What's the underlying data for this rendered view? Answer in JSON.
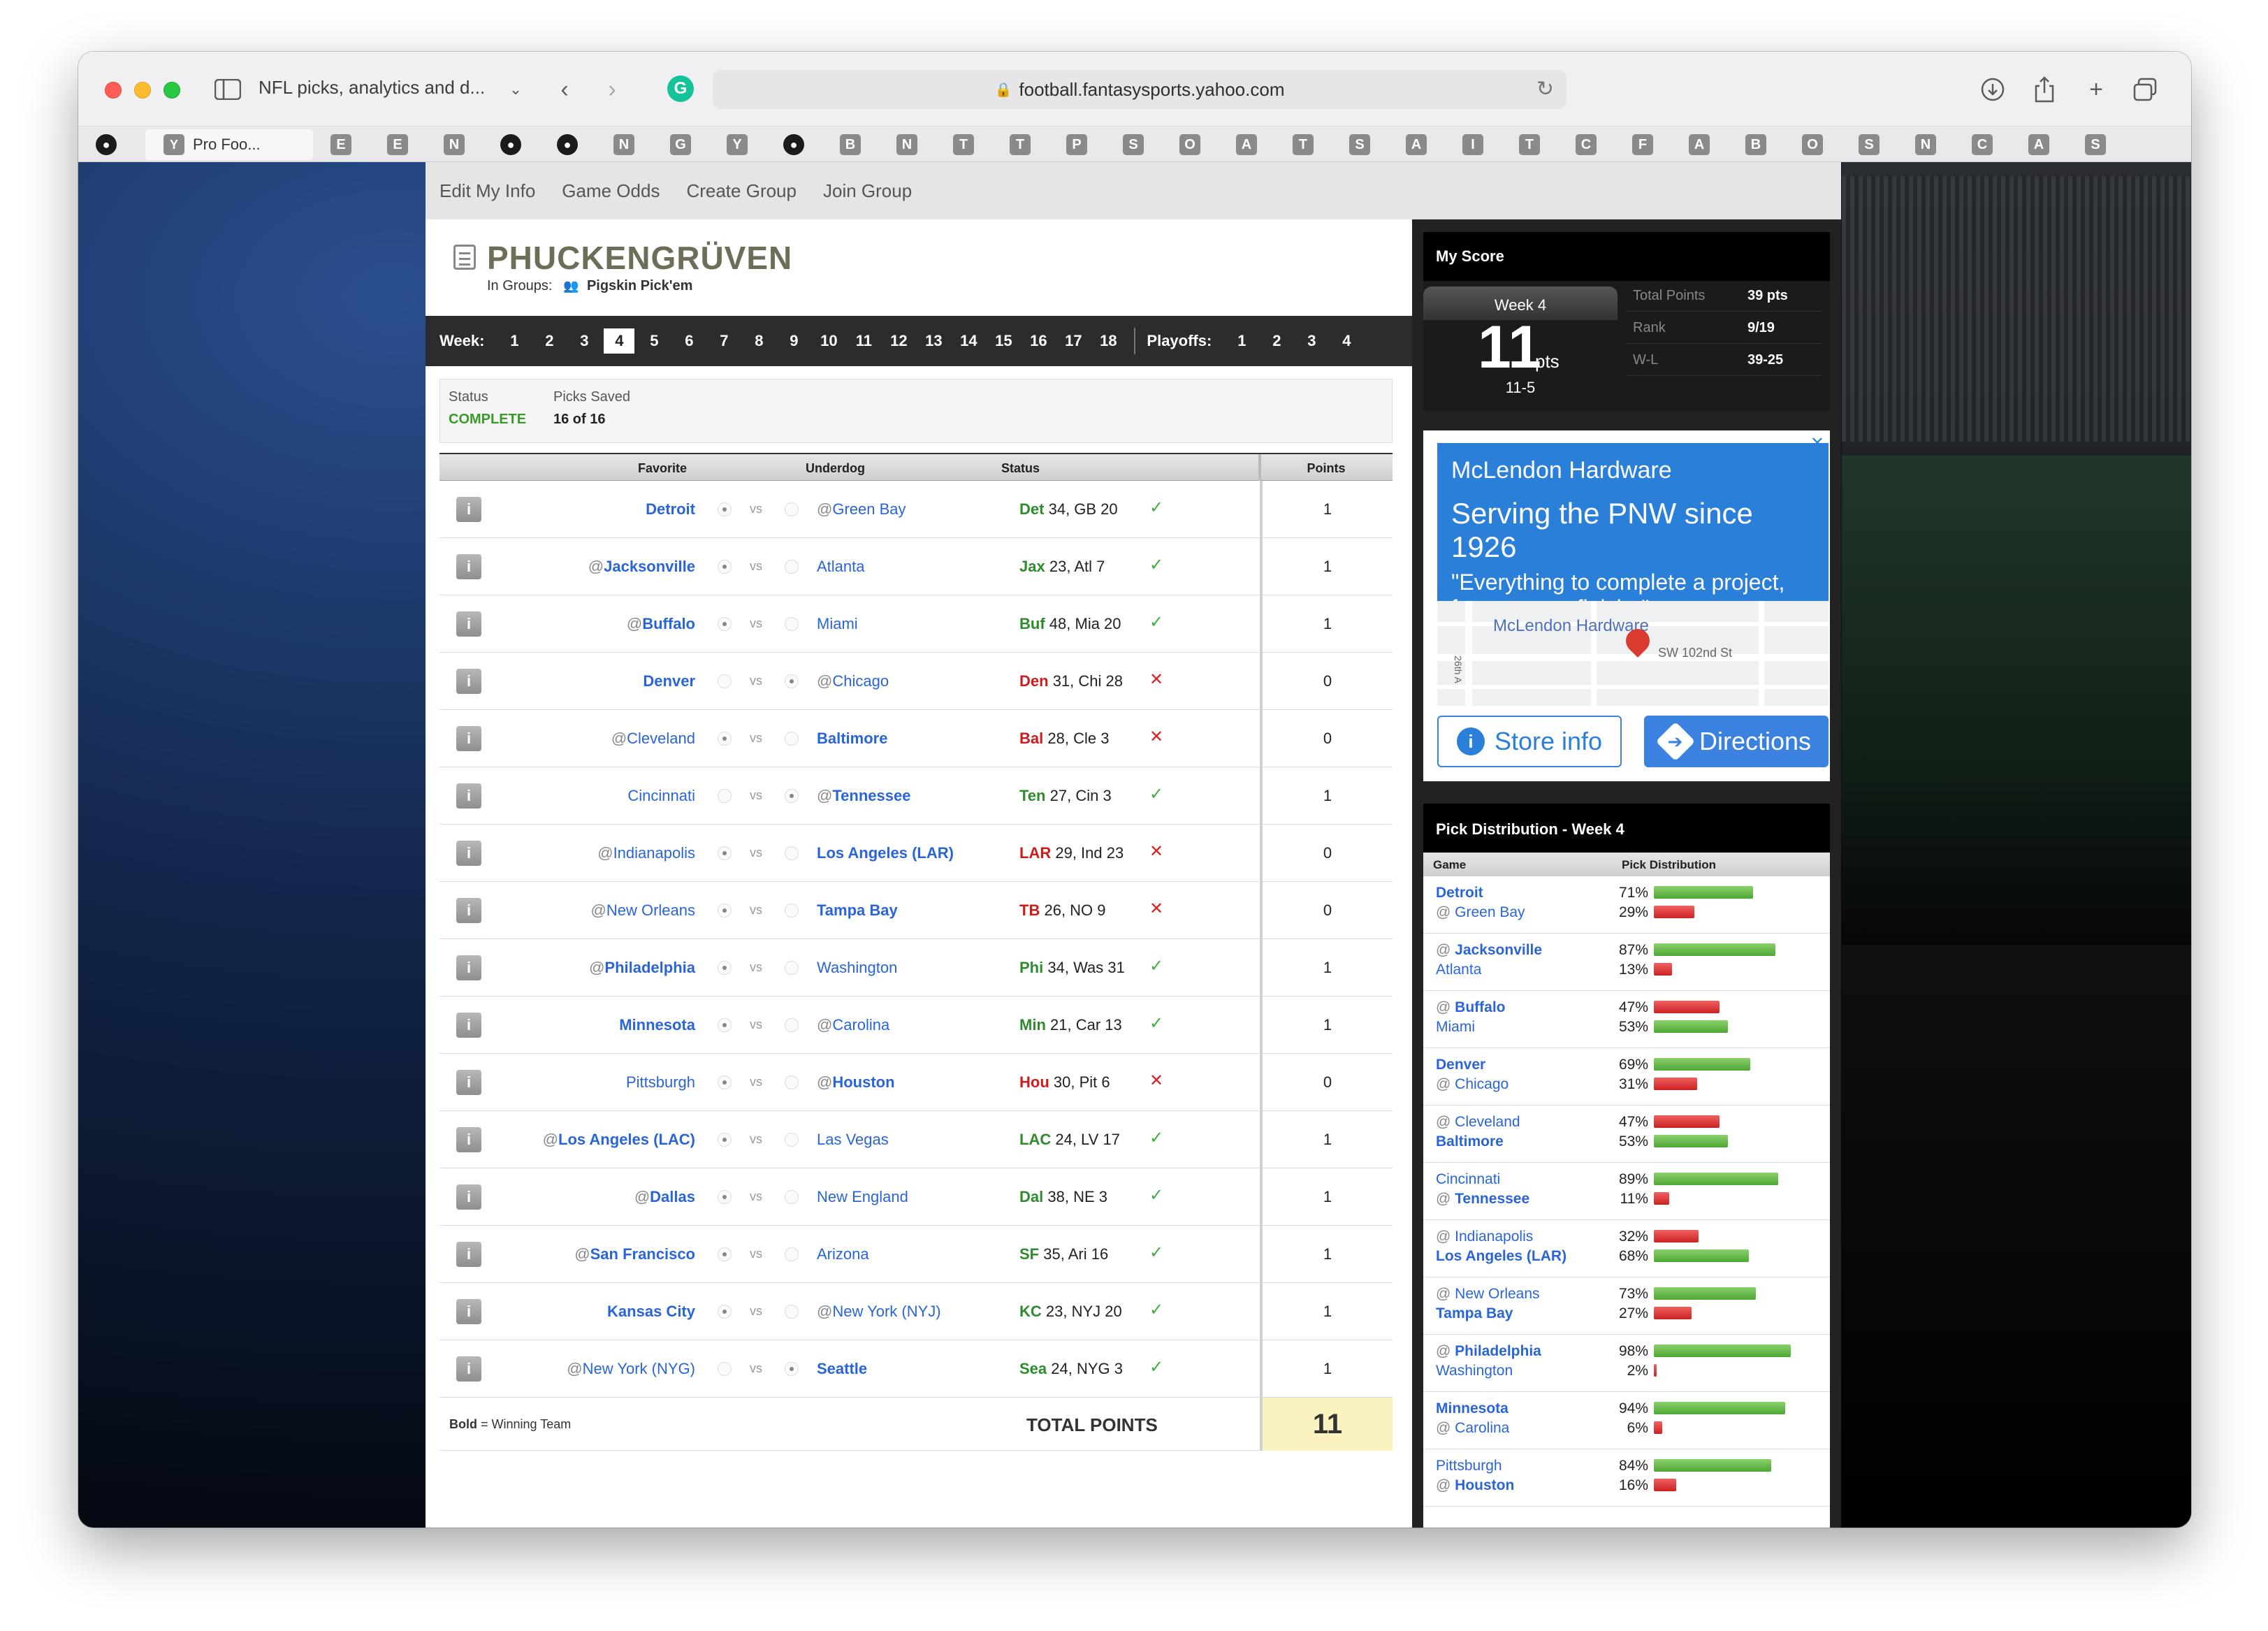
{
  "browser": {
    "tab_title": "NFL picks, analytics and d...",
    "url": "football.fantasysports.yahoo.com",
    "favorites": [
      {
        "kind": "gh",
        "letter": ""
      },
      {
        "kind": "active",
        "letter": "Y",
        "label": "Pro Foo..."
      },
      {
        "kind": "sq",
        "letter": "E"
      },
      {
        "kind": "sq",
        "letter": "E"
      },
      {
        "kind": "sq",
        "letter": "N"
      },
      {
        "kind": "gh",
        "letter": ""
      },
      {
        "kind": "gh",
        "letter": ""
      },
      {
        "kind": "sq",
        "letter": "N"
      },
      {
        "kind": "sq",
        "letter": "G"
      },
      {
        "kind": "sq",
        "letter": "Y"
      },
      {
        "kind": "gh",
        "letter": ""
      },
      {
        "kind": "sq",
        "letter": "B"
      },
      {
        "kind": "sq",
        "letter": "N"
      },
      {
        "kind": "sq",
        "letter": "T"
      },
      {
        "kind": "sq",
        "letter": "T"
      },
      {
        "kind": "sq",
        "letter": "P"
      },
      {
        "kind": "sq",
        "letter": "S"
      },
      {
        "kind": "sq",
        "letter": "O"
      },
      {
        "kind": "sq",
        "letter": "A"
      },
      {
        "kind": "sq",
        "letter": "T"
      },
      {
        "kind": "sq",
        "letter": "S"
      },
      {
        "kind": "sq",
        "letter": "A"
      },
      {
        "kind": "sq",
        "letter": "I"
      },
      {
        "kind": "sq",
        "letter": "T"
      },
      {
        "kind": "sq",
        "letter": "C"
      },
      {
        "kind": "sq",
        "letter": "F"
      },
      {
        "kind": "sq",
        "letter": "A"
      },
      {
        "kind": "sq",
        "letter": "B"
      },
      {
        "kind": "sq",
        "letter": "O"
      },
      {
        "kind": "sq",
        "letter": "S"
      },
      {
        "kind": "sq",
        "letter": "N"
      },
      {
        "kind": "sq",
        "letter": "C"
      },
      {
        "kind": "sq",
        "letter": "A"
      },
      {
        "kind": "sq",
        "letter": "S"
      }
    ]
  },
  "nav": {
    "links": [
      "Edit My Info",
      "Game Odds",
      "Create Group",
      "Join Group"
    ]
  },
  "header": {
    "title": "PHUCKENGRÜVEN",
    "groups_label": "In Groups:",
    "group_name": "Pigskin Pick'em"
  },
  "weeks": {
    "label": "Week:",
    "items": [
      "1",
      "2",
      "3",
      "4",
      "5",
      "6",
      "7",
      "8",
      "9",
      "10",
      "11",
      "12",
      "13",
      "14",
      "15",
      "16",
      "17",
      "18"
    ],
    "active": "4",
    "playoffs_label": "Playoffs:",
    "playoffs": [
      "1",
      "2",
      "3",
      "4"
    ]
  },
  "status": {
    "status_label": "Status",
    "status_value": "COMPLETE",
    "saved_label": "Picks Saved",
    "saved_value": "16 of 16"
  },
  "table": {
    "headers": {
      "favorite": "Favorite",
      "underdog": "Underdog",
      "status": "Status",
      "points": "Points"
    },
    "vs": "vs",
    "rows": [
      {
        "fav_at": false,
        "fav": "Detroit",
        "fav_bold": true,
        "und_at": true,
        "und": "Green Bay",
        "und_bold": false,
        "pick": "fav",
        "winner": "Det",
        "winner_score": "34",
        "rest": ", GB 20",
        "correct": true,
        "points": "1"
      },
      {
        "fav_at": true,
        "fav": "Jacksonville",
        "fav_bold": true,
        "und_at": false,
        "und": "Atlanta",
        "und_bold": false,
        "pick": "fav",
        "winner": "Jax",
        "winner_score": "23",
        "rest": ", Atl 7",
        "correct": true,
        "points": "1"
      },
      {
        "fav_at": true,
        "fav": "Buffalo",
        "fav_bold": true,
        "und_at": false,
        "und": "Miami",
        "und_bold": false,
        "pick": "fav",
        "winner": "Buf",
        "winner_score": "48",
        "rest": ", Mia 20",
        "correct": true,
        "points": "1"
      },
      {
        "fav_at": false,
        "fav": "Denver",
        "fav_bold": true,
        "und_at": true,
        "und": "Chicago",
        "und_bold": false,
        "pick": "und",
        "winner": "Den",
        "winner_score": "31",
        "rest": ", Chi 28",
        "correct": false,
        "points": "0"
      },
      {
        "fav_at": true,
        "fav": "Cleveland",
        "fav_bold": false,
        "und_at": false,
        "und": "Baltimore",
        "und_bold": true,
        "pick": "fav",
        "winner": "Bal",
        "winner_score": "28",
        "rest": ", Cle 3",
        "correct": false,
        "points": "0"
      },
      {
        "fav_at": false,
        "fav": "Cincinnati",
        "fav_bold": false,
        "und_at": true,
        "und": "Tennessee",
        "und_bold": true,
        "pick": "und",
        "winner": "Ten",
        "winner_score": "27",
        "rest": ", Cin 3",
        "correct": true,
        "points": "1"
      },
      {
        "fav_at": true,
        "fav": "Indianapolis",
        "fav_bold": false,
        "und_at": false,
        "und": "Los Angeles (LAR)",
        "und_bold": true,
        "pick": "fav",
        "winner": "LAR",
        "winner_score": "29",
        "rest": ", Ind 23",
        "correct": false,
        "points": "0"
      },
      {
        "fav_at": true,
        "fav": "New Orleans",
        "fav_bold": false,
        "und_at": false,
        "und": "Tampa Bay",
        "und_bold": true,
        "pick": "fav",
        "winner": "TB",
        "winner_score": "26",
        "rest": ", NO 9",
        "correct": false,
        "points": "0"
      },
      {
        "fav_at": true,
        "fav": "Philadelphia",
        "fav_bold": true,
        "und_at": false,
        "und": "Washington",
        "und_bold": false,
        "pick": "fav",
        "winner": "Phi",
        "winner_score": "34",
        "rest": ", Was 31",
        "correct": true,
        "points": "1"
      },
      {
        "fav_at": false,
        "fav": "Minnesota",
        "fav_bold": true,
        "und_at": true,
        "und": "Carolina",
        "und_bold": false,
        "pick": "fav",
        "winner": "Min",
        "winner_score": "21",
        "rest": ", Car 13",
        "correct": true,
        "points": "1"
      },
      {
        "fav_at": false,
        "fav": "Pittsburgh",
        "fav_bold": false,
        "und_at": true,
        "und": "Houston",
        "und_bold": true,
        "pick": "fav",
        "winner": "Hou",
        "winner_score": "30",
        "rest": ", Pit 6",
        "correct": false,
        "points": "0"
      },
      {
        "fav_at": true,
        "fav": "Los Angeles (LAC)",
        "fav_bold": true,
        "und_at": false,
        "und": "Las Vegas",
        "und_bold": false,
        "pick": "fav",
        "winner": "LAC",
        "winner_score": "24",
        "rest": ", LV 17",
        "correct": true,
        "points": "1"
      },
      {
        "fav_at": true,
        "fav": "Dallas",
        "fav_bold": true,
        "und_at": false,
        "und": "New England",
        "und_bold": false,
        "pick": "fav",
        "winner": "Dal",
        "winner_score": "38",
        "rest": ", NE 3",
        "correct": true,
        "points": "1"
      },
      {
        "fav_at": true,
        "fav": "San Francisco",
        "fav_bold": true,
        "und_at": false,
        "und": "Arizona",
        "und_bold": false,
        "pick": "fav",
        "winner": "SF",
        "winner_score": "35",
        "rest": ", Ari 16",
        "correct": true,
        "points": "1"
      },
      {
        "fav_at": false,
        "fav": "Kansas City",
        "fav_bold": true,
        "und_at": true,
        "und": "New York (NYJ)",
        "und_bold": false,
        "pick": "fav",
        "winner": "KC",
        "winner_score": "23",
        "rest": ", NYJ 20",
        "correct": true,
        "points": "1"
      },
      {
        "fav_at": true,
        "fav": "New York (NYG)",
        "fav_bold": false,
        "und_at": false,
        "und": "Seattle",
        "und_bold": true,
        "pick": "und",
        "winner": "Sea",
        "winner_score": "24",
        "rest": ", NYG 3",
        "correct": true,
        "points": "1"
      }
    ],
    "footer": {
      "legend_bold": "Bold",
      "legend_rest": " = Winning Team",
      "total_label": "TOTAL POINTS",
      "total_value": "11"
    }
  },
  "my_score": {
    "title": "My Score",
    "week_label": "Week 4",
    "points": "11",
    "pts_label": "pts",
    "record": "11-5",
    "stats": [
      {
        "label": "Total Points",
        "value": "39 pts"
      },
      {
        "label": "Rank",
        "value": "9/19"
      },
      {
        "label": "W-L",
        "value": "39-25"
      }
    ]
  },
  "ad": {
    "name": "McLendon Hardware",
    "headline": "Serving the PNW since 1926",
    "sub": "\"Everything to complete a project, from start to finish. \"",
    "map_name": "McLendon Hardware",
    "map_street": "SW 102nd St",
    "map_street2": "26th A",
    "store_btn": "Store info",
    "dir_btn": "Directions"
  },
  "distribution": {
    "title": "Pick Distribution - Week 4",
    "col_game": "Game",
    "col_dist": "Pick Distribution",
    "rows": [
      {
        "t1_at": false,
        "t1": "Detroit",
        "t1_bold": true,
        "p1": 71,
        "t1_win": true,
        "t2_at": true,
        "t2": "Green Bay",
        "t2_bold": false,
        "p2": 29
      },
      {
        "t1_at": true,
        "t1": "Jacksonville",
        "t1_bold": true,
        "p1": 87,
        "t1_win": true,
        "t2_at": false,
        "t2": "Atlanta",
        "t2_bold": false,
        "p2": 13
      },
      {
        "t1_at": true,
        "t1": "Buffalo",
        "t1_bold": true,
        "p1": 47,
        "t1_win": false,
        "t2_at": false,
        "t2": "Miami",
        "t2_bold": false,
        "p2": 53
      },
      {
        "t1_at": false,
        "t1": "Denver",
        "t1_bold": true,
        "p1": 69,
        "t1_win": true,
        "t2_at": true,
        "t2": "Chicago",
        "t2_bold": false,
        "p2": 31
      },
      {
        "t1_at": true,
        "t1": "Cleveland",
        "t1_bold": false,
        "p1": 47,
        "t1_win": false,
        "t2_at": false,
        "t2": "Baltimore",
        "t2_bold": true,
        "p2": 53
      },
      {
        "t1_at": false,
        "t1": "Cincinnati",
        "t1_bold": false,
        "p1": 89,
        "t1_win": true,
        "t2_at": true,
        "t2": "Tennessee",
        "t2_bold": true,
        "p2": 11
      },
      {
        "t1_at": true,
        "t1": "Indianapolis",
        "t1_bold": false,
        "p1": 32,
        "t1_win": false,
        "t2_at": false,
        "t2": "Los Angeles (LAR)",
        "t2_bold": true,
        "p2": 68
      },
      {
        "t1_at": true,
        "t1": "New Orleans",
        "t1_bold": false,
        "p1": 73,
        "t1_win": true,
        "t2_at": false,
        "t2": "Tampa Bay",
        "t2_bold": true,
        "p2": 27
      },
      {
        "t1_at": true,
        "t1": "Philadelphia",
        "t1_bold": true,
        "p1": 98,
        "t1_win": true,
        "t2_at": false,
        "t2": "Washington",
        "t2_bold": false,
        "p2": 2
      },
      {
        "t1_at": false,
        "t1": "Minnesota",
        "t1_bold": true,
        "p1": 94,
        "t1_win": true,
        "t2_at": true,
        "t2": "Carolina",
        "t2_bold": false,
        "p2": 6
      },
      {
        "t1_at": false,
        "t1": "Pittsburgh",
        "t1_bold": false,
        "p1": 84,
        "t1_win": true,
        "t2_at": true,
        "t2": "Houston",
        "t2_bold": true,
        "p2": 16
      }
    ]
  },
  "colors": {
    "link_blue": "#2a65d8",
    "win_green": "#2e8b2e",
    "loss_red": "#cc1c1c",
    "check_green": "#3fae3f",
    "bar_green": "#4da634",
    "bar_red": "#cc2222",
    "ad_blue": "#2a7fd9"
  }
}
